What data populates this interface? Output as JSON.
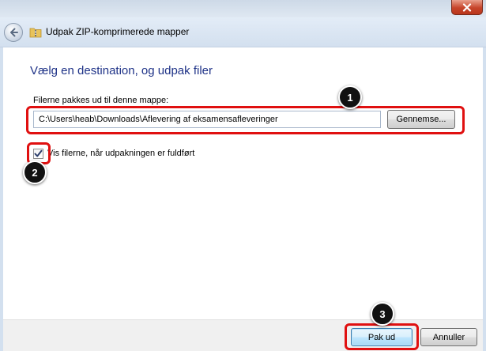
{
  "window": {
    "title": "Udpak ZIP-komprimerede mapper",
    "close_icon": "close-icon",
    "back_icon": "back-arrow-icon",
    "folder_icon": "zip-folder-icon"
  },
  "main": {
    "heading": "Vælg en destination, og udpak filer",
    "destination_label": "Filerne pakkes ud til denne mappe:",
    "destination_path": "C:\\Users\\heab\\Downloads\\Aflevering af eksamensafleveringer",
    "browse_button": "Gennemse...",
    "show_files_checkbox": {
      "label": "Vis filerne, når udpakningen er fuldført",
      "checked": true
    }
  },
  "footer": {
    "extract_button": "Pak ud",
    "cancel_button": "Annuller"
  },
  "annotations": {
    "step1": "1",
    "step2": "2",
    "step3": "3",
    "color": "#e01010"
  },
  "colors": {
    "heading": "#1e3287",
    "primary_button_border": "#3c7fb1"
  }
}
